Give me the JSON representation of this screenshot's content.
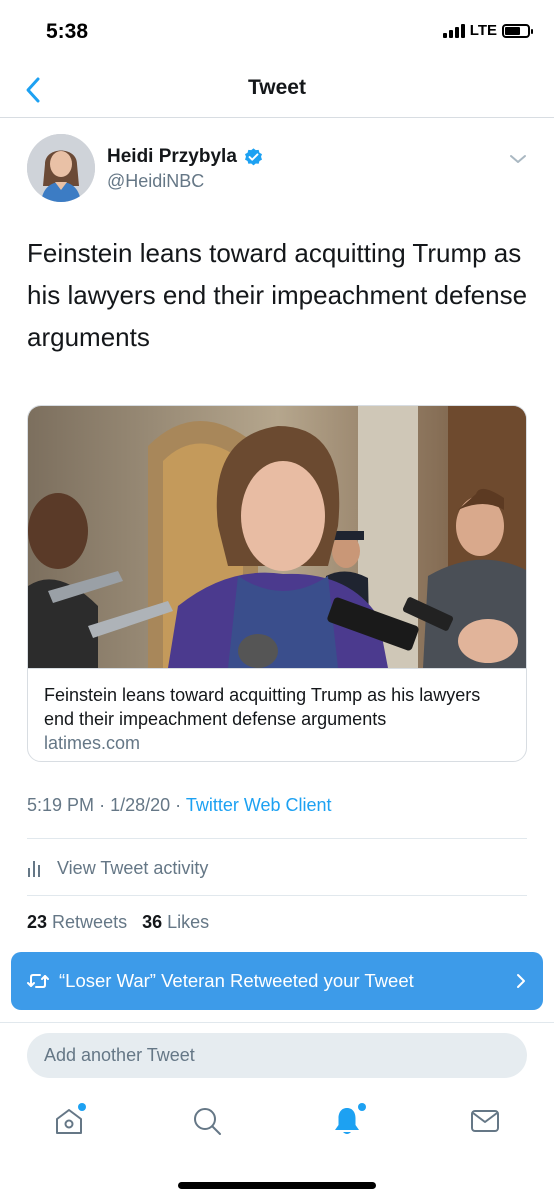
{
  "status_bar": {
    "time": "5:38",
    "network": "LTE",
    "battery_level": 0.7
  },
  "nav": {
    "back_icon": "chevron-left-icon",
    "title": "Tweet"
  },
  "tweet": {
    "author_name": "Heidi Przybyla",
    "author_handle": "@HeidiNBC",
    "verified": true,
    "text": "Feinstein leans toward acquitting Trump as his lawyers end their impeachment defense arguments",
    "card": {
      "title": "Feinstein leans toward acquitting Trump as his lawyers end their impeachment defense arguments",
      "domain": "latimes.com"
    },
    "time": "5:19 PM",
    "date": "1/28/20",
    "separator": "·",
    "source": "Twitter Web Client",
    "activity_label": "View Tweet activity",
    "retweets_count": "23",
    "retweets_label": "Retweets",
    "likes_count": "36",
    "likes_label": "Likes"
  },
  "notification": {
    "text": "“Loser War” Veteran Retweeted your Tweet"
  },
  "reply": {
    "placeholder": "Add another Tweet"
  },
  "tab_bar": {
    "items": [
      "home-icon",
      "search-icon",
      "notifications-icon",
      "messages-icon"
    ]
  },
  "colors": {
    "accent": "#1da1f2",
    "banner": "#3d9be9",
    "secondary_text": "#657786",
    "divider": "#e1e8ed"
  }
}
